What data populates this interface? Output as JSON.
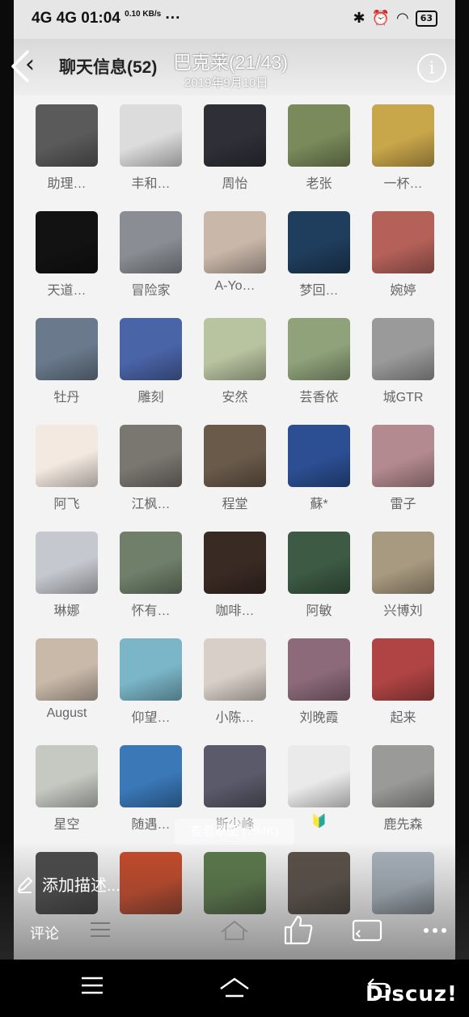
{
  "status_bar": {
    "network": "4G 4G",
    "time": "01:04",
    "speed": "0.10 KB/s",
    "more": "···",
    "battery": "63"
  },
  "header": {
    "title": "聊天信息(52)"
  },
  "viewer": {
    "title": "巴克莱(21/43)",
    "date": "2019年9月10日",
    "info_icon": "info-icon",
    "view_original": "查看原图 (794K)",
    "add_description": "添加描述...",
    "comment": "评论"
  },
  "members": [
    {
      "name": "助理…",
      "bg": "#5a5a5a"
    },
    {
      "name": "丰和…",
      "bg": "#dcdcdc"
    },
    {
      "name": "周怡",
      "bg": "#2f2f38"
    },
    {
      "name": "老张",
      "bg": "#7a8a5a"
    },
    {
      "name": "一杯…",
      "bg": "#c8a64a"
    },
    {
      "name": "天道…",
      "bg": "#121212"
    },
    {
      "name": "冒险家",
      "bg": "#8a8e94"
    },
    {
      "name": "A-Yo…",
      "bg": "#c9b7a9"
    },
    {
      "name": "梦回…",
      "bg": "#1f3d5c"
    },
    {
      "name": "婉婷",
      "bg": "#b5615a"
    },
    {
      "name": "牡丹",
      "bg": "#6a7a8c"
    },
    {
      "name": "雕刻",
      "bg": "#4a64a8"
    },
    {
      "name": "安然",
      "bg": "#b8c3a0"
    },
    {
      "name": "芸香依",
      "bg": "#8fa27a"
    },
    {
      "name": "城GTR",
      "bg": "#9a9a9a"
    },
    {
      "name": "阿飞",
      "bg": "#f4e9e1"
    },
    {
      "name": "江枫…",
      "bg": "#7a7670"
    },
    {
      "name": "程堂",
      "bg": "#6a5a4a"
    },
    {
      "name": "蘇*",
      "bg": "#2c4f94"
    },
    {
      "name": "雷子",
      "bg": "#b38a8f"
    },
    {
      "name": "琳娜",
      "bg": "#c5c8ce"
    },
    {
      "name": "怀有…",
      "bg": "#6f7f6a"
    },
    {
      "name": "咖啡…",
      "bg": "#3a2a24"
    },
    {
      "name": "阿敏",
      "bg": "#3c5a44"
    },
    {
      "name": "兴博刘",
      "bg": "#a89a80"
    },
    {
      "name": "August",
      "bg": "#c9b9a9"
    },
    {
      "name": "仰望…",
      "bg": "#7ab6c8"
    },
    {
      "name": "小陈…",
      "bg": "#d8d0c8"
    },
    {
      "name": "刘晚霞",
      "bg": "#8c6a7a"
    },
    {
      "name": "起来",
      "bg": "#b04444"
    },
    {
      "name": "星空",
      "bg": "#c6c9c2"
    },
    {
      "name": "随遇…",
      "bg": "#3a78b8"
    },
    {
      "name": "斯少峰",
      "bg": "#5a5a6a"
    },
    {
      "name": "🔰",
      "bg": "#eaeaea"
    },
    {
      "name": "鹿先森",
      "bg": "#9a9a98"
    },
    {
      "name": "",
      "bg": "#4a4a4a"
    },
    {
      "name": "",
      "bg": "#c64a2a"
    },
    {
      "name": "",
      "bg": "#5a7a4a"
    },
    {
      "name": "",
      "bg": "#5a5048"
    },
    {
      "name": "",
      "bg": "#a8b2bc"
    }
  ],
  "watermark": "Discuz!"
}
